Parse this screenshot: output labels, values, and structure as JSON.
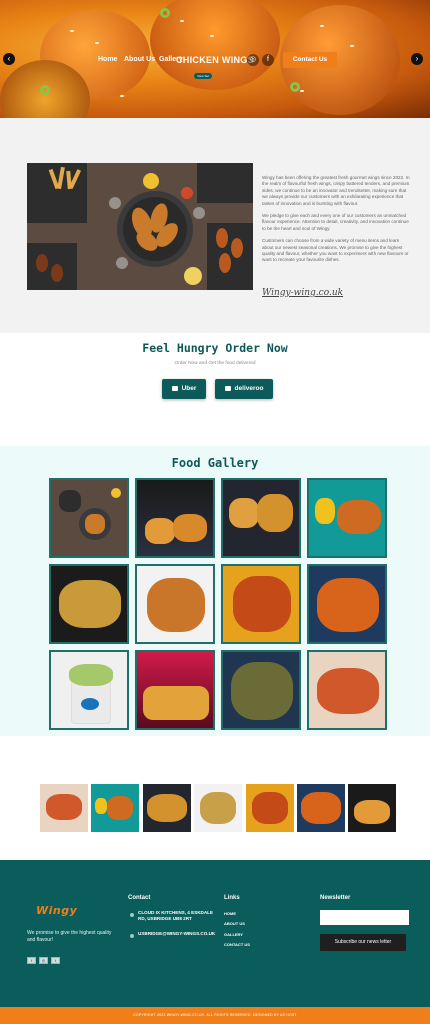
{
  "hero": {
    "nav": {
      "home": "Home",
      "about": "About Us",
      "gallery": "Gallery"
    },
    "title": "CHICKEN WINGS",
    "contact_button": "Contact Us",
    "pill": "View Sel",
    "prev_icon": "chevron-left-icon",
    "next_icon": "chevron-right-icon",
    "instagram_icon": "instagram-icon",
    "facebook_icon": "facebook-icon"
  },
  "about": {
    "paragraphs": [
      "Wingy has been offering the greatest fresh gourmet wings since 2022. In the realm of flavourful fresh wings, crispy battered tenders, and premium sides, we continue to be an innovator and trendsetter, making sure that we always provide our customers with an exhilarating experience that tastes of innovation and is bursting with flavour.",
      "We pledge to give each and every one of our customers an unmatched flavour experience. Attention to detail, creativity, and innovation continue to be the heart and soul of Wingy.",
      "Customers can choose from a wide variety of menu items and learn about our newest seasonal creations. We promise to give the highest quality and flavour, whether you want to experiment with new flavours or want to recreate your favourite dishes."
    ],
    "signature": "Wingy-wing.co.uk"
  },
  "order": {
    "title": "Feel Hungry Order Now",
    "subtitle": "Order Now and Get the food delivered",
    "buttons": [
      "Uber",
      "deliveroo"
    ]
  },
  "gallery": {
    "title": "Food Gallery"
  },
  "footer": {
    "logo": "Wingy",
    "tagline": "We promise to give the highest quality and flavour!",
    "contact_heading": "Contact",
    "address": "CLOUD IX KITCHENS, 4 ESKDALE RD, UXBRIDGE UB8 2RT",
    "email": "UXBRIDGE@WINGY-WINGS.CO.UK",
    "links_heading": "Links",
    "links": [
      "HOME",
      "ABOUT US",
      "GALLERY",
      "CONTACT US"
    ],
    "newsletter_heading": "Newsletter",
    "newsletter_placeholder": "",
    "newsletter_button": "Subscribe our news letter",
    "social_icons": [
      "facebook-icon",
      "instagram-icon",
      "twitter-icon"
    ]
  },
  "copyright": "COPYRIGHT 2023 WINGY-WING.CO.UK. ALL RIGHTS RESERVED. DESIGNED BY AS HOST",
  "colors": {
    "brand_teal": "#0c5b5a",
    "brand_orange": "#f07e19",
    "gallery_bg": "#ecfbfa"
  }
}
